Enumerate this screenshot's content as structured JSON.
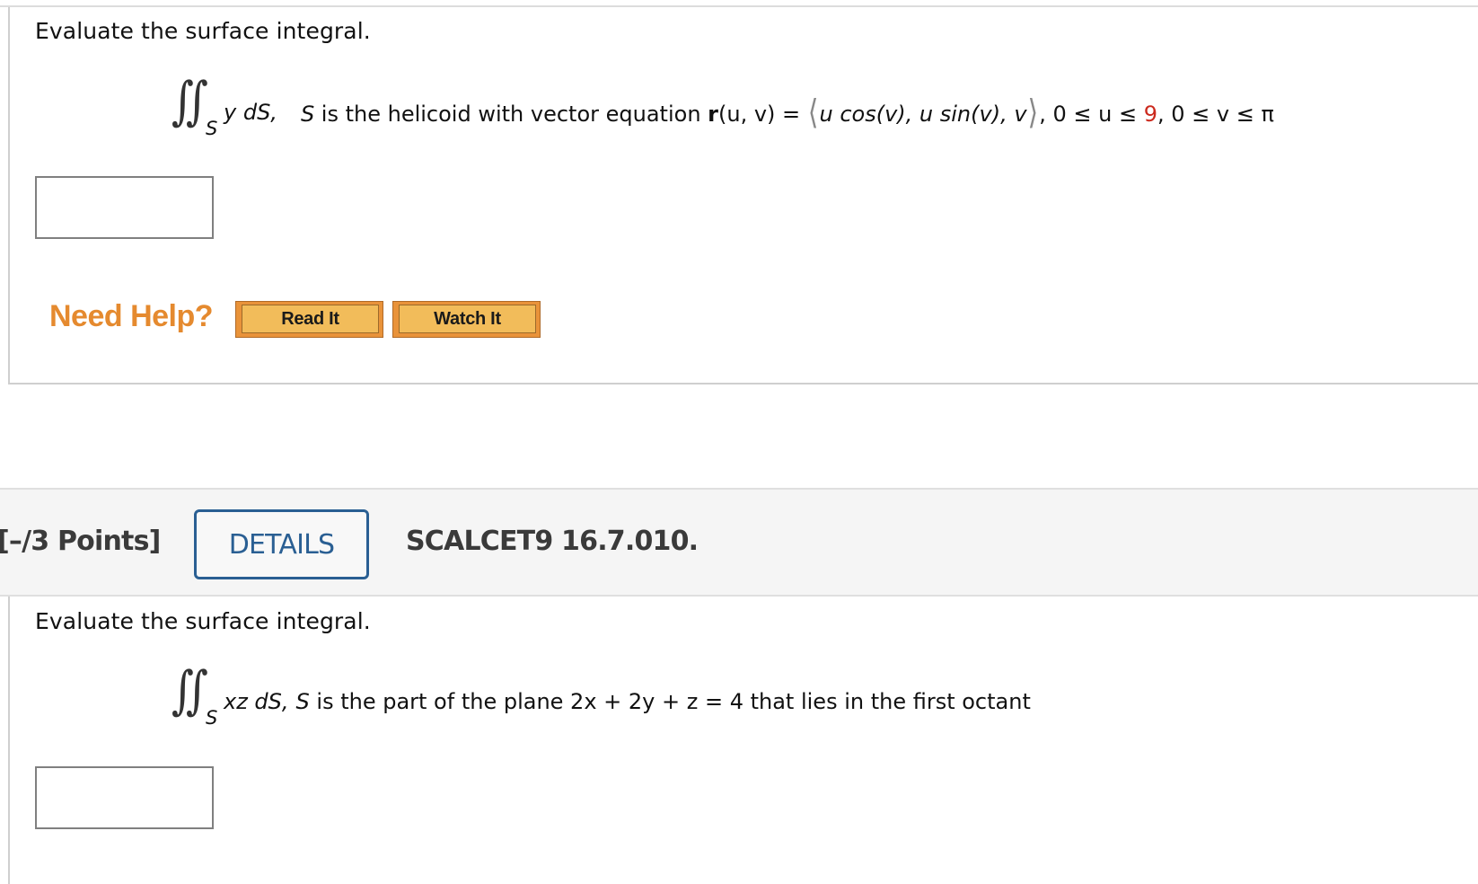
{
  "question1": {
    "prompt": "Evaluate the surface integral.",
    "integral_subscript": "S",
    "integrand": "y dS,",
    "desc_S": "S",
    "desc_text": " is the helicoid with vector equation ",
    "r": "r",
    "r_args": "(u, v) = ",
    "vec_comp1": "u cos(v), u sin(v), v",
    "after_vec": ", 0 ≤ u ≤ ",
    "u_max": "9",
    "v_range": ", 0 ≤ v ≤ π",
    "answer_value": "",
    "need_help_label": "Need Help?",
    "read_it_label": "Read It",
    "watch_it_label": "Watch It"
  },
  "question2": {
    "points_label": "[–/3 Points]",
    "details_label": "DETAILS",
    "problem_id": "SCALCET9 16.7.010.",
    "prompt": "Evaluate the surface integral.",
    "integral_subscript": "S",
    "integrand": "xz dS,",
    "desc_S": "S",
    "desc_text": " is the part of the plane 2x + 2y + z = 4 that lies in the first octant",
    "answer_value": ""
  },
  "colors": {
    "accent_red": "#cc2a1e",
    "need_help_orange": "#e58a2f",
    "details_blue": "#2a5f93",
    "button_gold": "#f2bc5a"
  }
}
